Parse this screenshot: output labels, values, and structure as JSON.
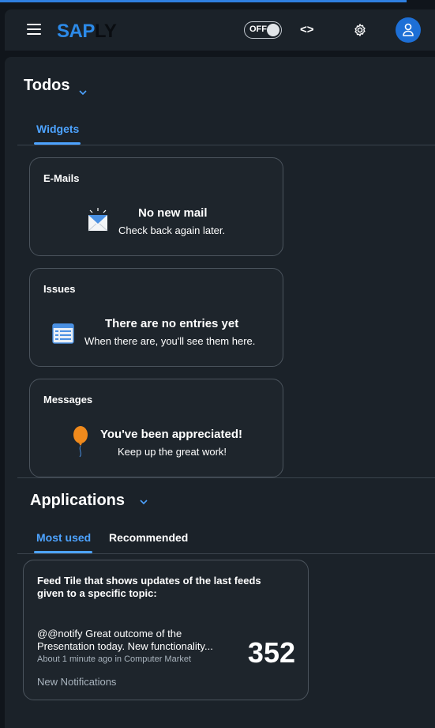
{
  "shell": {
    "logo_primary": "SAP",
    "logo_secondary": "LY",
    "toggle_label": "OFF"
  },
  "todos": {
    "title": "Todos",
    "tabs": [
      {
        "label": "Widgets",
        "active": true
      }
    ],
    "widgets": [
      {
        "title": "E-Mails",
        "main": "No new mail",
        "sub": "Check back again later.",
        "icon": "mail-icon"
      },
      {
        "title": "Issues",
        "main": "There are no entries yet",
        "sub": "When there are, you'll see them here.",
        "icon": "list-icon"
      },
      {
        "title": "Messages",
        "main": "You've been appreciated!",
        "sub": "Keep up the great work!",
        "icon": "balloon-icon"
      }
    ]
  },
  "applications": {
    "title": "Applications",
    "tabs": [
      {
        "label": "Most used",
        "active": true
      },
      {
        "label": "Recommended",
        "active": false
      }
    ],
    "feed_tile": {
      "title": "Feed Tile that shows updates of the last feeds given to a specific topic:",
      "message": "@@notify Great outcome of the Presentation today. New functionality...",
      "meta": "About 1 minute ago in Computer Market",
      "count": "352",
      "footer": "New Notifications"
    }
  },
  "colors": {
    "accent": "#4da3ff",
    "avatar": "#1d6fd6",
    "balloon": "#f08a1c"
  }
}
